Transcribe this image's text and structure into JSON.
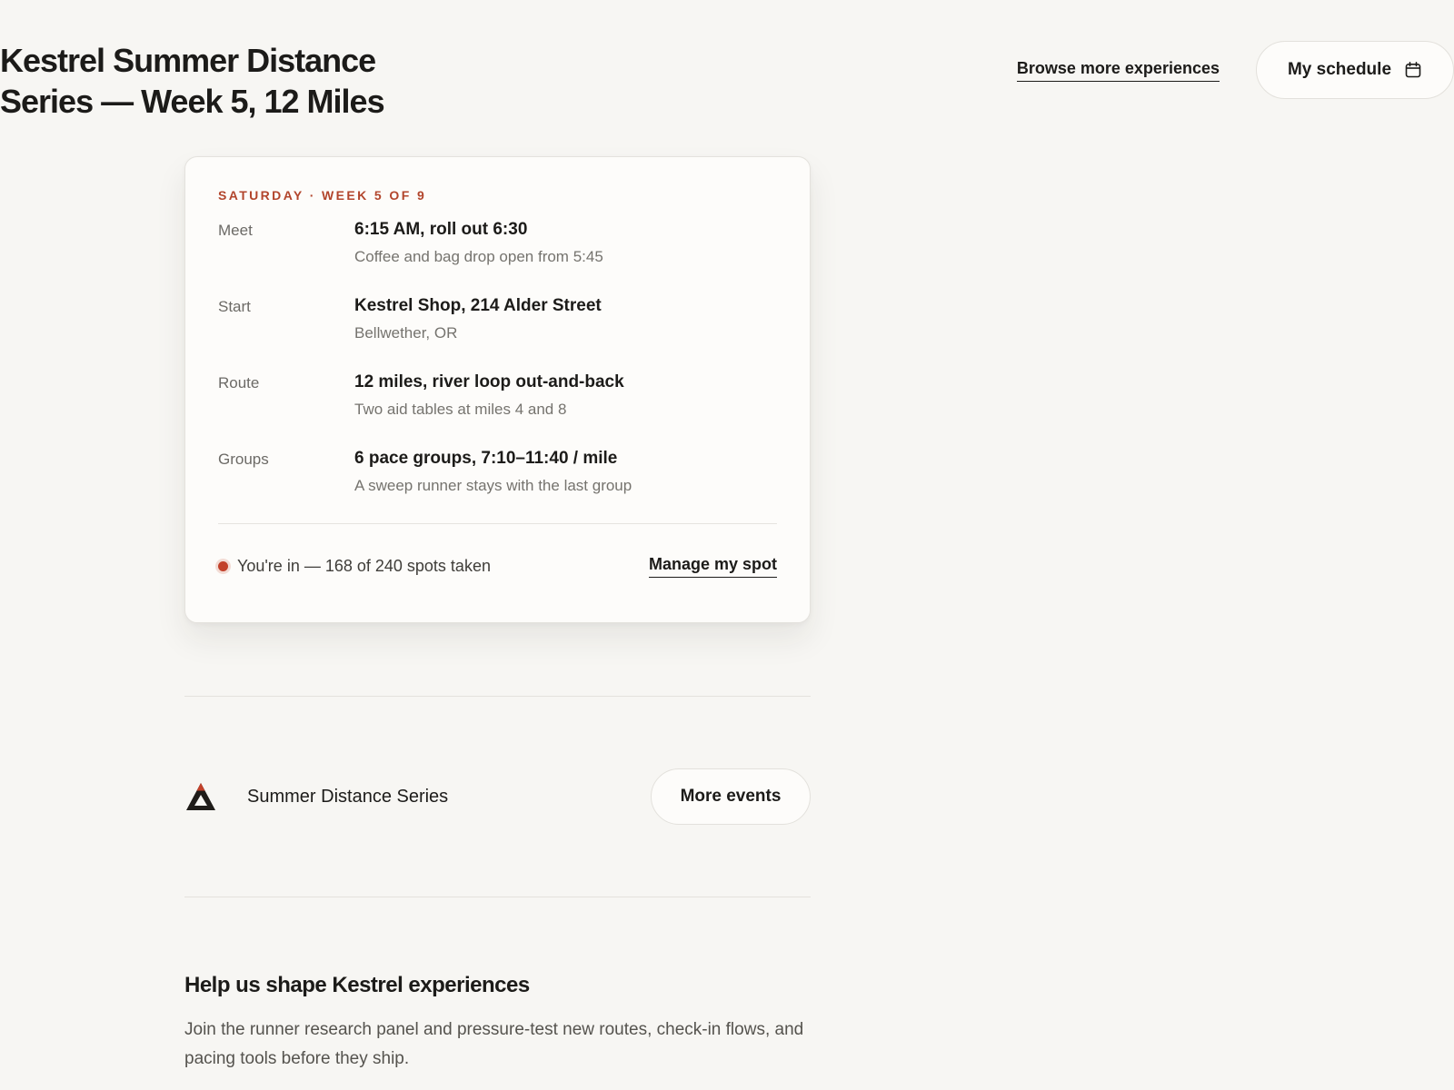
{
  "header": {
    "title": "Kestrel Summer Distance Series — Week 5, 12 Miles",
    "browse_label": "Browse more experiences",
    "schedule_label": "My schedule",
    "schedule_icon": "calendar-icon"
  },
  "event_card": {
    "eyebrow": "SATURDAY · WEEK 5 OF 9",
    "details": [
      {
        "label": "Meet",
        "main": "6:15 AM, roll out 6:30",
        "sub": "Coffee and bag drop open from 5:45"
      },
      {
        "label": "Start",
        "main": "Kestrel Shop, 214 Alder Street",
        "sub": "Bellwether, OR"
      },
      {
        "label": "Route",
        "main": "12 miles, river loop out-and-back",
        "sub": "Two aid tables at miles 4 and 8"
      },
      {
        "label": "Groups",
        "main": "6 pace groups, 7:10–11:40 / mile",
        "sub": "A sweep runner stays with the last group"
      }
    ],
    "status_text": "You're in — 168 of 240 spots taken",
    "status_color": "#c2412a",
    "manage_label": "Manage my spot"
  },
  "series": {
    "logo_icon": "kestrel-triangle-logo",
    "name": "Summer Distance Series",
    "more_label": "More events"
  },
  "research": {
    "title": "Help us shape Kestrel experiences",
    "body": "Join the runner research panel and pressure-test new routes, check-in flows, and pacing tools before they ship."
  },
  "colors": {
    "accent": "#b2452c",
    "background": "#f7f6f3",
    "card": "#fdfcfa",
    "text": "#1c1b19"
  }
}
